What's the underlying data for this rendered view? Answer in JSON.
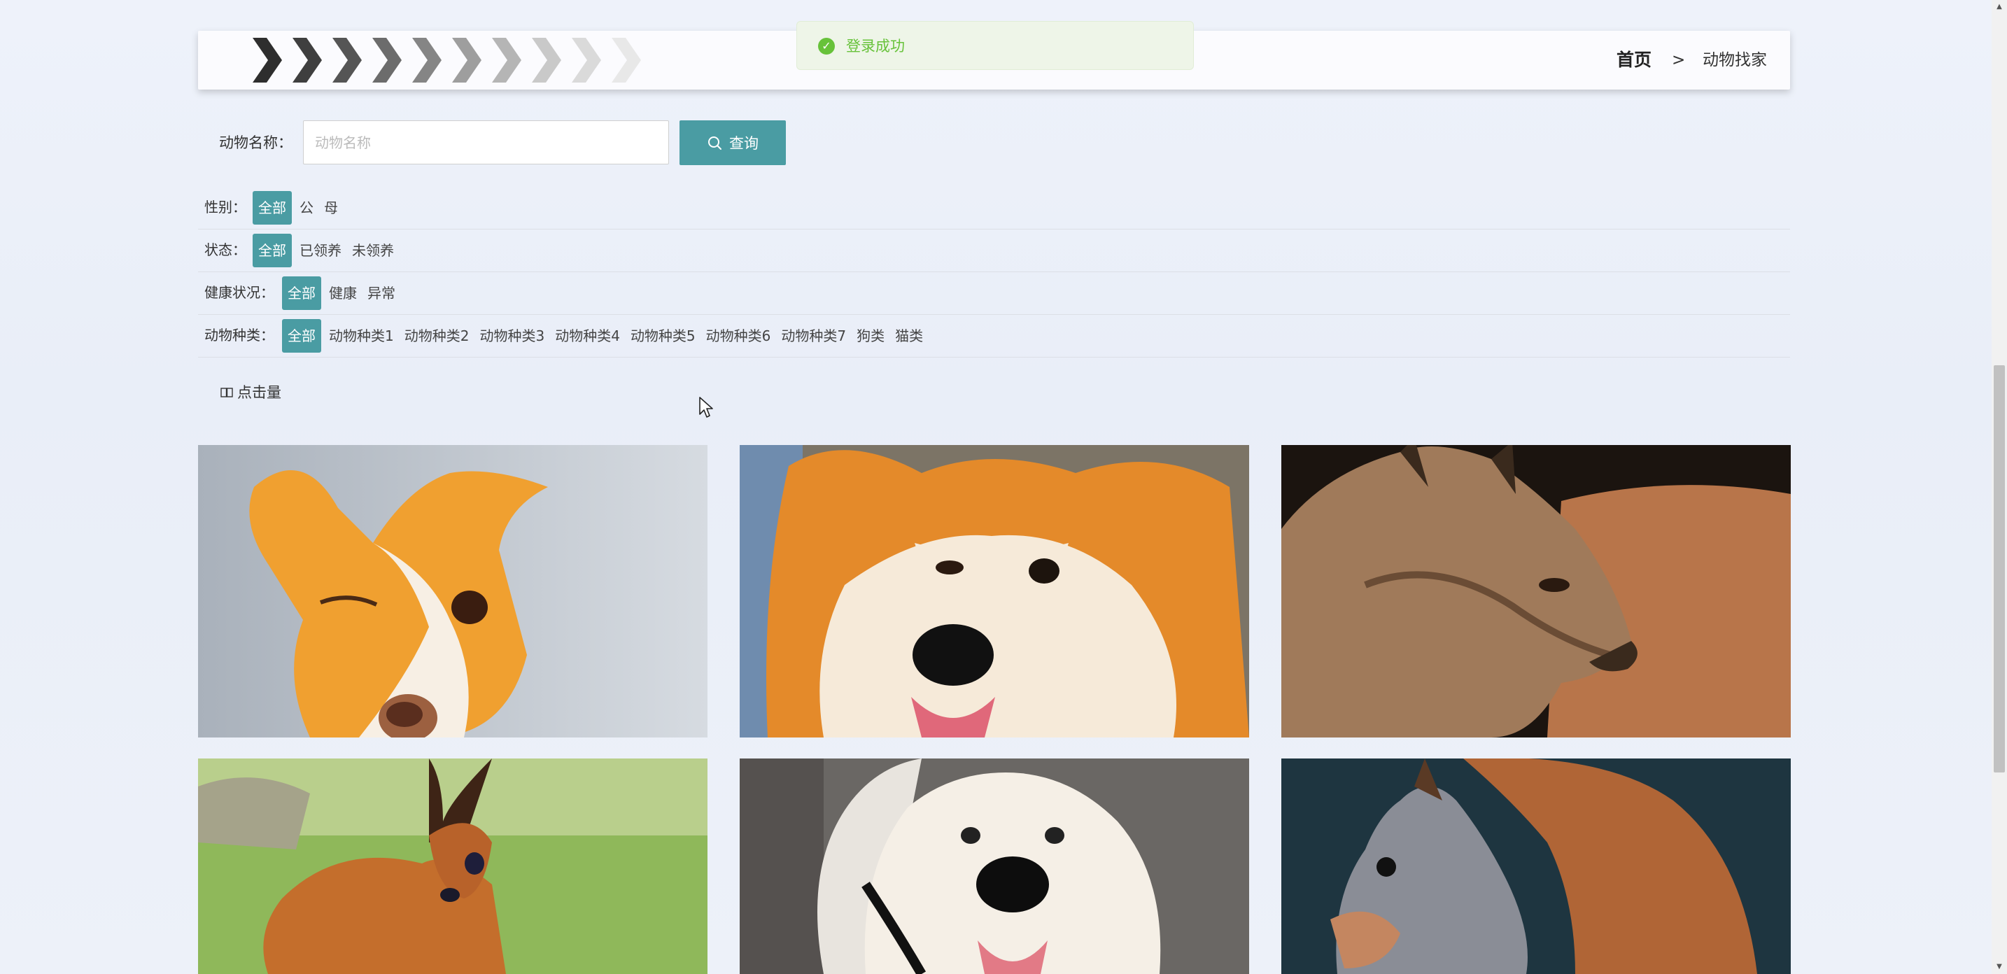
{
  "toast": {
    "message": "登录成功",
    "icon": "check-circle-icon",
    "color": "#67c23a"
  },
  "breadcrumb": {
    "home": "首页",
    "separator": ">",
    "current": "动物找家"
  },
  "search": {
    "label": "动物名称：",
    "placeholder": "动物名称",
    "value": "",
    "button_label": "查询",
    "button_icon": "search-icon"
  },
  "filters": [
    {
      "title": "性别：",
      "options": [
        "全部",
        "公",
        "母"
      ],
      "selected": "全部"
    },
    {
      "title": "状态：",
      "options": [
        "全部",
        "已领养",
        "未领养"
      ],
      "selected": "全部"
    },
    {
      "title": "健康状况：",
      "options": [
        "全部",
        "健康",
        "异常"
      ],
      "selected": "全部"
    },
    {
      "title": "动物种类：",
      "options": [
        "全部",
        "动物种类1",
        "动物种类2",
        "动物种类3",
        "动物种类4",
        "动物种类5",
        "动物种类6",
        "动物种类7",
        "狗类",
        "猫类"
      ],
      "selected": "全部"
    }
  ],
  "sort": {
    "label": "点击量",
    "icon": "book-icon"
  },
  "animals": [
    {
      "photo": "chihuahua-photo"
    },
    {
      "photo": "shiba-inu-photo"
    },
    {
      "photo": "lynx-photo"
    },
    {
      "photo": "deer-photo"
    },
    {
      "photo": "samoyed-photo"
    },
    {
      "photo": "squirrel-photo"
    }
  ],
  "colors": {
    "accent": "#4a9ca3",
    "success": "#67c23a"
  }
}
